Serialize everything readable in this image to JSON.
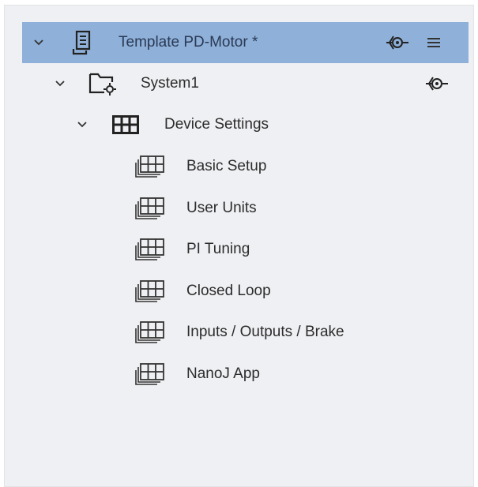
{
  "tree": {
    "root": {
      "label": "Template PD-Motor *",
      "icon": "document-icon",
      "actions": [
        "connect-icon",
        "menu-icon"
      ]
    },
    "system": {
      "label": "System1",
      "icon": "folder-settings-icon",
      "actions": [
        "connect-icon"
      ]
    },
    "device_settings": {
      "label": "Device Settings",
      "icon": "grid-icon"
    },
    "items": [
      {
        "label": "Basic Setup",
        "icon": "table-stack-icon"
      },
      {
        "label": "User Units",
        "icon": "table-stack-icon"
      },
      {
        "label": "PI Tuning",
        "icon": "table-stack-icon"
      },
      {
        "label": "Closed Loop",
        "icon": "table-stack-icon"
      },
      {
        "label": "Inputs / Outputs / Brake",
        "icon": "table-stack-icon"
      },
      {
        "label": "NanoJ App",
        "icon": "table-stack-icon"
      }
    ]
  },
  "colors": {
    "selected_row": "#8fb0d8",
    "panel_bg": "#eff0f3",
    "text": "#2c2c2c"
  }
}
